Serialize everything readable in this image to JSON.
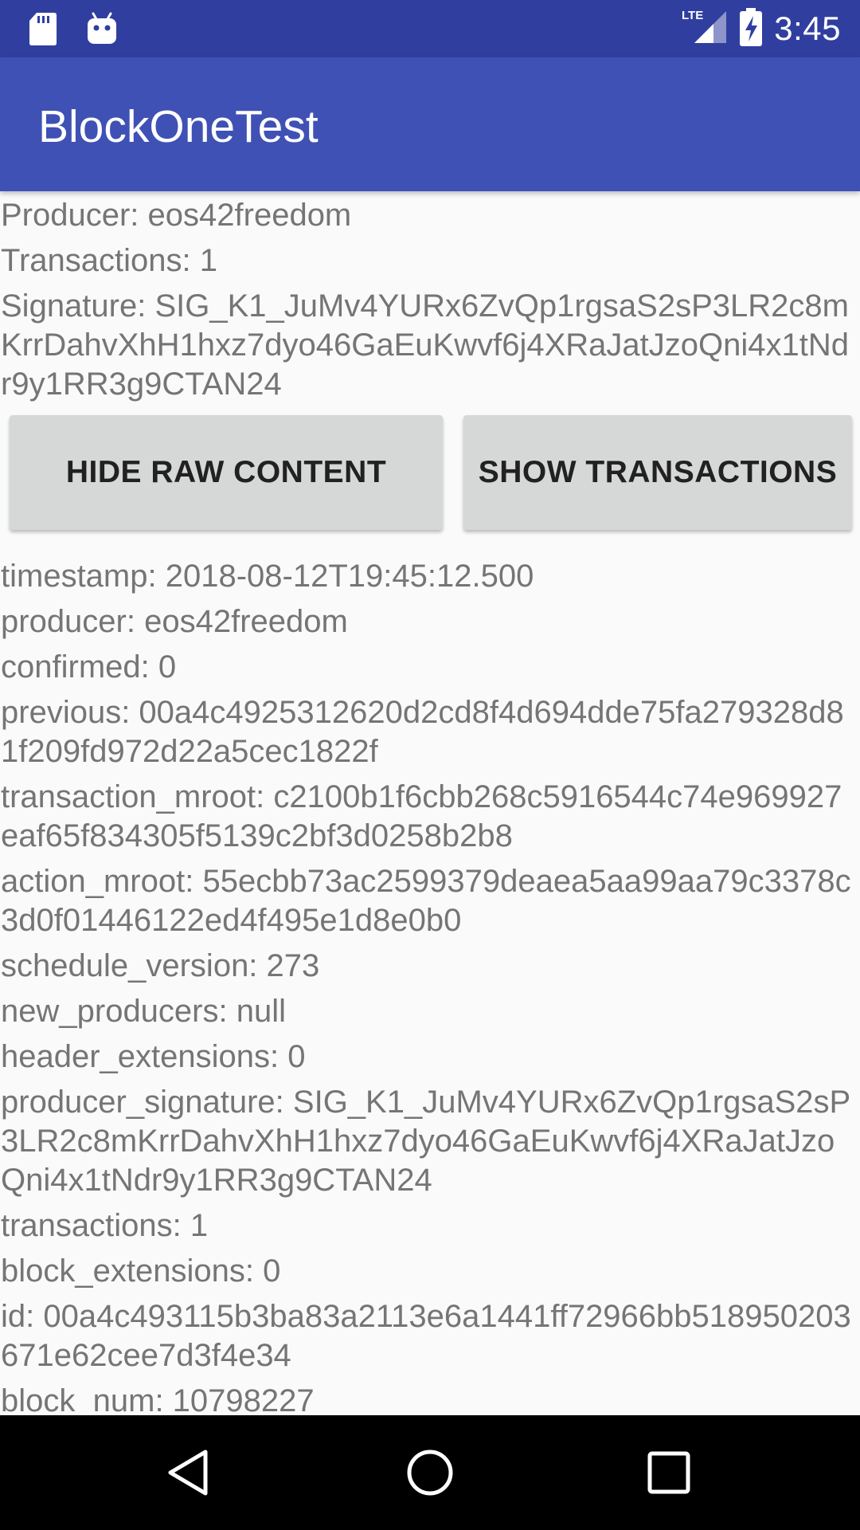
{
  "status_bar": {
    "time": "3:45",
    "network": "LTE",
    "icons": [
      "sd-card-icon",
      "android-debug-icon",
      "lte-signal-icon",
      "battery-charging-icon"
    ]
  },
  "app_bar": {
    "title": "BlockOneTest"
  },
  "summary": {
    "producer": "Producer: eos42freedom",
    "transactions": "Transactions: 1",
    "signature": "Signature: SIG_K1_JuMv4YURx6ZvQp1rgsaS2sP3LR2c8mKrrDahvXhH1hxz7dyo46GaEuKwvf6j4XRaJatJzoQni4x1tNdr9y1RR3g9CTAN24"
  },
  "buttons": {
    "hide_raw": "HIDE RAW CONTENT",
    "show_transactions": "SHOW TRANSACTIONS"
  },
  "raw": [
    "timestamp: 2018-08-12T19:45:12.500",
    "producer: eos42freedom",
    "confirmed: 0",
    "previous: 00a4c4925312620d2cd8f4d694dde75fa279328d81f209fd972d22a5cec1822f",
    "transaction_mroot: c2100b1f6cbb268c5916544c74e969927eaf65f834305f5139c2bf3d0258b2b8",
    "action_mroot: 55ecbb73ac2599379deaea5aa99aa79c3378c3d0f01446122ed4f495e1d8e0b0",
    "schedule_version: 273",
    "new_producers: null",
    "header_extensions: 0",
    "producer_signature: SIG_K1_JuMv4YURx6ZvQp1rgsaS2sP3LR2c8mKrrDahvXhH1hxz7dyo46GaEuKwvf6j4XRaJatJzoQni4x1tNdr9y1RR3g9CTAN24",
    "transactions: 1",
    "block_extensions: 0",
    "id: 00a4c493115b3ba83a2113e6a1441ff72966bb518950203671e62cee7d3f4e34",
    "block_num: 10798227"
  ],
  "nav_bar": {
    "icons": [
      "back-icon",
      "home-icon",
      "recents-icon"
    ]
  },
  "colors": {
    "status_bar": "#303f9f",
    "app_bar": "#3f51b5",
    "background": "#fafafa",
    "text": "#757575",
    "button": "#d6d7d7"
  }
}
